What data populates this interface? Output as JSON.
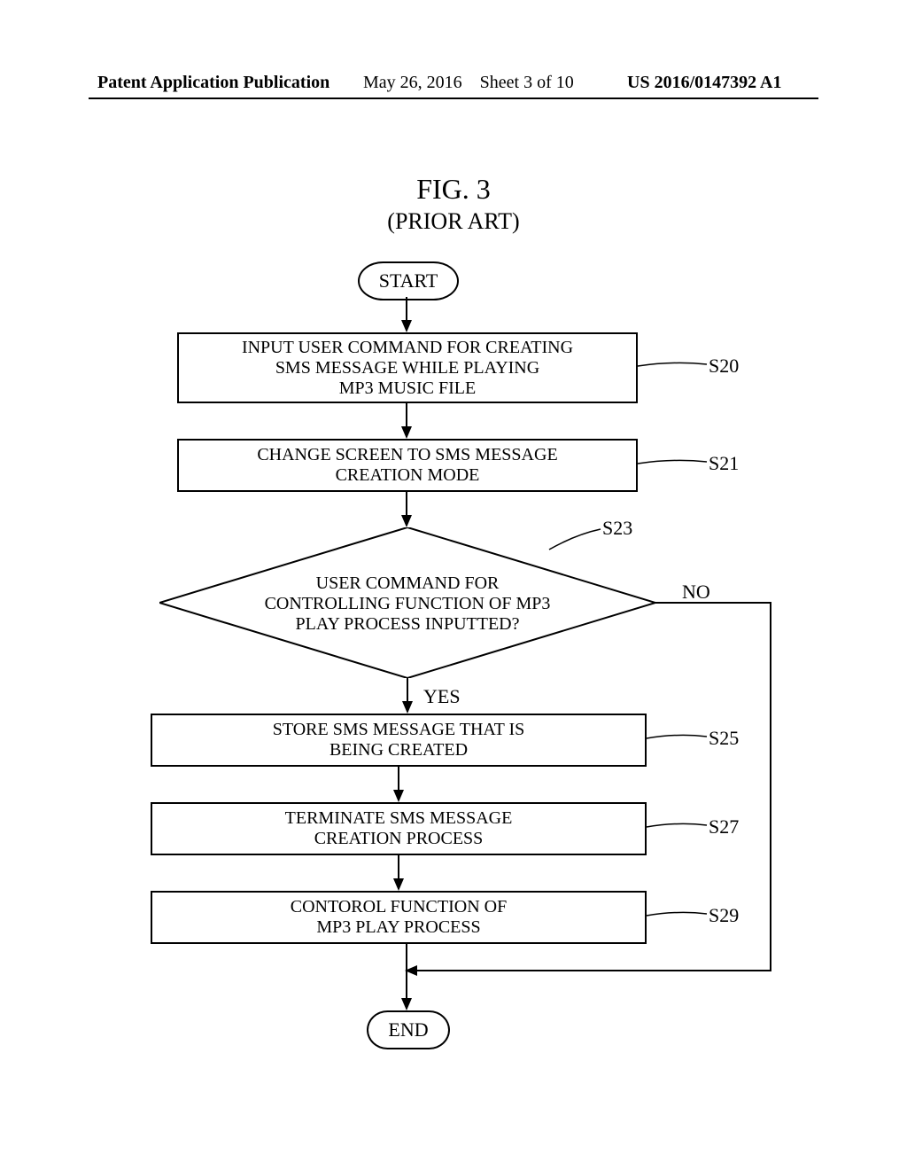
{
  "header": {
    "left": "Patent Application Publication",
    "mid_date": "May 26, 2016",
    "mid_sheet": "Sheet 3 of 10",
    "right": "US 2016/0147392 A1"
  },
  "figure": {
    "title": "FIG. 3",
    "subtitle": "(PRIOR ART)"
  },
  "flow": {
    "start": "START",
    "end": "END",
    "s20": {
      "text": "INPUT USER COMMAND FOR CREATING\nSMS MESSAGE WHILE PLAYING\nMP3 MUSIC FILE",
      "label": "S20"
    },
    "s21": {
      "text": "CHANGE SCREEN TO SMS MESSAGE\nCREATION MODE",
      "label": "S21"
    },
    "s23": {
      "text": "USER COMMAND FOR\nCONTROLLING FUNCTION OF MP3\nPLAY PROCESS INPUTTED?",
      "label": "S23"
    },
    "s25": {
      "text": "STORE SMS MESSAGE THAT IS\nBEING CREATED",
      "label": "S25"
    },
    "s27": {
      "text": "TERMINATE SMS MESSAGE\nCREATION PROCESS",
      "label": "S27"
    },
    "s29": {
      "text": "CONTOROL FUNCTION OF\nMP3 PLAY PROCESS",
      "label": "S29"
    },
    "yes": "YES",
    "no": "NO"
  }
}
